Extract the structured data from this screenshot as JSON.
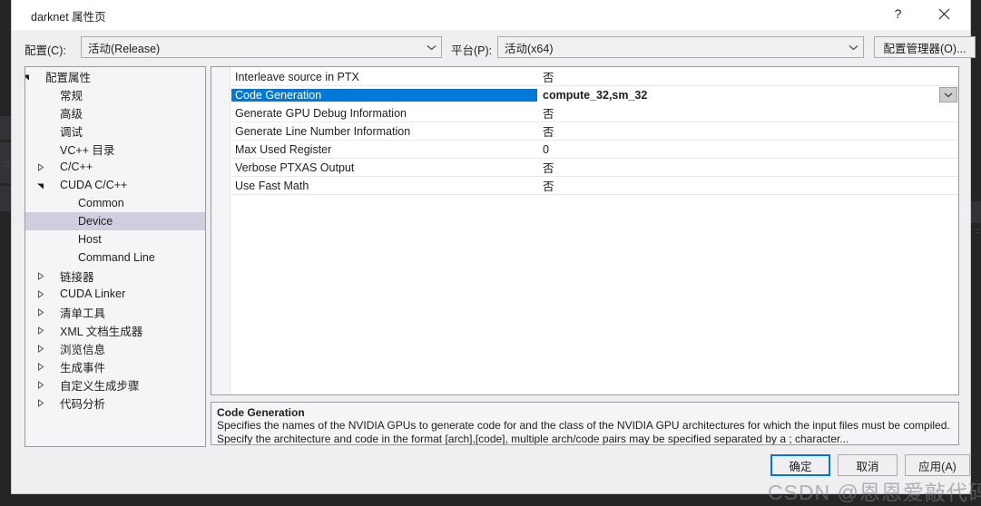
{
  "window": {
    "title": "darknet 属性页",
    "help_button": "?",
    "close_button": "×"
  },
  "config_bar": {
    "configuration_label": "配置(C):",
    "configuration_value": "活动(Release)",
    "platform_label": "平台(P):",
    "platform_value": "活动(x64)",
    "config_manager_button": "配置管理器(O)..."
  },
  "tree": {
    "items": [
      {
        "label": "配置属性",
        "indent": 0,
        "arrow": "expanded",
        "selected": false
      },
      {
        "label": "常规",
        "indent": 1,
        "arrow": "none",
        "selected": false
      },
      {
        "label": "高级",
        "indent": 1,
        "arrow": "none",
        "selected": false
      },
      {
        "label": "调试",
        "indent": 1,
        "arrow": "none",
        "selected": false
      },
      {
        "label": "VC++ 目录",
        "indent": 1,
        "arrow": "none",
        "selected": false
      },
      {
        "label": "C/C++",
        "indent": 1,
        "arrow": "collapsed",
        "selected": false
      },
      {
        "label": "CUDA C/C++",
        "indent": 1,
        "arrow": "expanded",
        "selected": false
      },
      {
        "label": "Common",
        "indent": 2,
        "arrow": "none",
        "selected": false
      },
      {
        "label": "Device",
        "indent": 2,
        "arrow": "none",
        "selected": true
      },
      {
        "label": "Host",
        "indent": 2,
        "arrow": "none",
        "selected": false
      },
      {
        "label": "Command Line",
        "indent": 2,
        "arrow": "none",
        "selected": false
      },
      {
        "label": "链接器",
        "indent": 1,
        "arrow": "collapsed",
        "selected": false
      },
      {
        "label": "CUDA Linker",
        "indent": 1,
        "arrow": "collapsed",
        "selected": false
      },
      {
        "label": "清单工具",
        "indent": 1,
        "arrow": "collapsed",
        "selected": false
      },
      {
        "label": "XML 文档生成器",
        "indent": 1,
        "arrow": "collapsed",
        "selected": false
      },
      {
        "label": "浏览信息",
        "indent": 1,
        "arrow": "collapsed",
        "selected": false
      },
      {
        "label": "生成事件",
        "indent": 1,
        "arrow": "collapsed",
        "selected": false
      },
      {
        "label": "自定义生成步骤",
        "indent": 1,
        "arrow": "collapsed",
        "selected": false
      },
      {
        "label": "代码分析",
        "indent": 1,
        "arrow": "collapsed",
        "selected": false
      }
    ]
  },
  "property_grid": {
    "rows": [
      {
        "name": "Interleave source in PTX",
        "value": "否",
        "selected": false
      },
      {
        "name": "Code Generation",
        "value": "compute_32,sm_32",
        "selected": true
      },
      {
        "name": "Generate GPU Debug Information",
        "value": "否",
        "selected": false
      },
      {
        "name": "Generate Line Number Information",
        "value": "否",
        "selected": false
      },
      {
        "name": "Max Used Register",
        "value": "0",
        "selected": false
      },
      {
        "name": "Verbose PTXAS Output",
        "value": "否",
        "selected": false
      },
      {
        "name": "Use Fast Math",
        "value": "否",
        "selected": false
      }
    ]
  },
  "description": {
    "title": "Code Generation",
    "text": "Specifies the names of the NVIDIA GPUs to generate code for and the class of the NVIDIA GPU architectures for which the input files must be compiled.  Specify the architecture and code in the format [arch],[code], multiple arch/code pairs may be specified separated by a ; character..."
  },
  "footer": {
    "ok_label": "确定",
    "cancel_label": "取消",
    "apply_label": "应用(A)"
  },
  "watermark": {
    "text": "CSDN @恩恩爱敲代码"
  },
  "colors": {
    "accent": "#0078d7",
    "dialog_bg": "#efeff2",
    "tree_selection": "#cdcede",
    "ide_backdrop": "#252526"
  }
}
